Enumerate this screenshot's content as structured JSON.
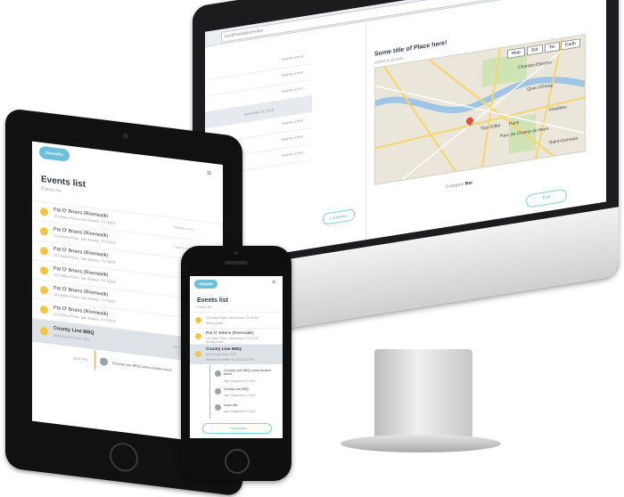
{
  "imac": {
    "browser": {
      "url": "localhost/places/list"
    },
    "place_detail": {
      "title": "Some title of Place here!",
      "subtitle": "added to private",
      "map_buttons": [
        "Map",
        "Sat",
        "Ter",
        "Earth"
      ],
      "map_labels": [
        "Champs-Elysées",
        "Quai d'Orsay",
        "Tour Eiffel",
        "Paris",
        "Parc du Champ de Mars",
        "Invalides",
        "Saint-Germain"
      ],
      "category_label": "Category",
      "category_value": "Bar",
      "exit_button": "Exit"
    },
    "left_list": {
      "rows": [
        {
          "tag": "Nearby event"
        },
        {
          "tag": "Nearby event"
        },
        {
          "tag": "Nearby event"
        },
        {
          "date": "December 8, 2016",
          "tag": "Selected"
        },
        {
          "tag": "Nearby event"
        },
        {
          "tag": "Nearby event"
        },
        {
          "tag": "Nearby event"
        }
      ],
      "add_button": "+ Add place"
    }
  },
  "ipad": {
    "logo": "GlassyBar",
    "title": "Events list",
    "subtitle": "Places list",
    "events": [
      {
        "name": "Pat O' Briens (Riverwalk)",
        "addr": "121 Alamo Plaza, San Antonio, TX 78205",
        "tag": "Nearby event"
      },
      {
        "name": "Pat O' Briens (Riverwalk)",
        "addr": "121 Alamo Plaza, San Antonio, TX 78205",
        "tag": "Nearby event"
      },
      {
        "name": "Pat O' Briens (Riverwalk)",
        "addr": "121 Alamo Plaza, San Antonio, TX 78205",
        "tag": ""
      },
      {
        "name": "Pat O' Briens (Riverwalk)",
        "addr": "121 Alamo Plaza, San Antonio, TX 78205",
        "tag": ""
      },
      {
        "name": "Pat O' Briens (Riverwalk)",
        "addr": "121 Alamo Plaza, San Antonio, TX 78205",
        "tag": ""
      },
      {
        "name": "Pat O' Briens (Riverwalk)",
        "addr": "121 Alamo Plaza, San Antonio, TX 78205",
        "tag": ""
      },
      {
        "name": "County Line BBQ",
        "addr": "6026 Nordic Road, 2022",
        "tag": "December 8"
      }
    ],
    "timeline": {
      "time": "10:00 PM",
      "text": "(County Line BBQ) some another event"
    }
  },
  "iphone": {
    "logo": "GlassyBar",
    "title": "Events list",
    "subtitle": "Places list",
    "rows": [
      {
        "name": "",
        "addr": "121 Alamo Plaza, San Antonio, TX 78205",
        "tag": "Nearby event"
      },
      {
        "name": "Pat O' Briens (Riverwalk)",
        "addr": "121 Alamo Plaza, San Antonio, TX 78205",
        "tag": "Nearby event"
      },
      {
        "name": "County Line BBQ",
        "addr": "6026 Nordic Road, 2022",
        "date": "Selected   December 8, 2016   10:00 PM"
      }
    ],
    "timeline": [
      {
        "text": "(County Line BBQ) some another event",
        "date": "date: September 8, 2016"
      },
      {
        "text": "County Line BBQ",
        "date": "date: September 8, 2016"
      },
      {
        "text": "some title",
        "date": "date: September 8, 2016"
      }
    ],
    "add_button": "+ Add place"
  }
}
